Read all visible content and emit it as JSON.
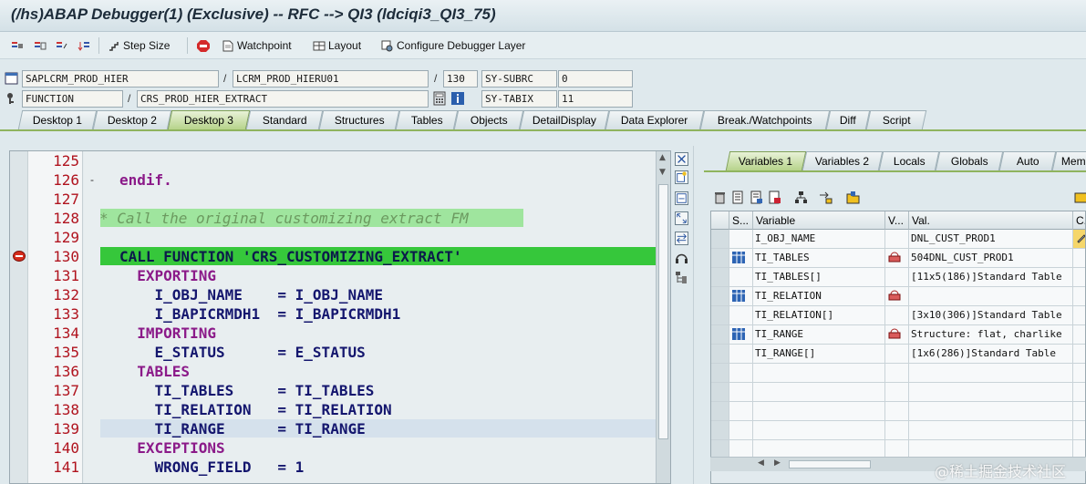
{
  "window": {
    "title": "(/hs)ABAP Debugger(1)  (Exclusive) -- RFC --> QI3 (ldciqi3_QI3_75)"
  },
  "toolbar": {
    "step_size": "Step Size",
    "watchpoint": "Watchpoint",
    "layout": "Layout",
    "configure": "Configure Debugger Layer"
  },
  "info": {
    "program": "SAPLCRM_PROD_HIER",
    "include": "LCRM_PROD_HIERU01",
    "line": "130",
    "subrc_label": "SY-SUBRC",
    "subrc_value": "0",
    "event_type": "FUNCTION",
    "event_name": "CRS_PROD_HIER_EXTRACT",
    "tabix_label": "SY-TABIX",
    "tabix_value": "11"
  },
  "tabs": [
    "Desktop 1",
    "Desktop 2",
    "Desktop 3",
    "Standard",
    "Structures",
    "Tables",
    "Objects",
    "DetailDisplay",
    "Data Explorer",
    "Break./Watchpoints",
    "Diff",
    "Script"
  ],
  "active_tab": "Desktop 3",
  "code": {
    "lines": [
      {
        "n": "125",
        "text": ""
      },
      {
        "n": "126",
        "text": "endif."
      },
      {
        "n": "127",
        "text": ""
      },
      {
        "n": "128",
        "text": "* Call the original customizing extract FM"
      },
      {
        "n": "129",
        "text": ""
      },
      {
        "n": "130",
        "text": "CALL FUNCTION 'CRS_CUSTOMIZING_EXTRACT'"
      },
      {
        "n": "131",
        "text": "  EXPORTING"
      },
      {
        "n": "132",
        "text": "    I_OBJ_NAME    = I_OBJ_NAME"
      },
      {
        "n": "133",
        "text": "    I_BAPICRMDH1  = I_BAPICRMDH1"
      },
      {
        "n": "134",
        "text": "  IMPORTING"
      },
      {
        "n": "135",
        "text": "    E_STATUS      = E_STATUS"
      },
      {
        "n": "136",
        "text": "  TABLES"
      },
      {
        "n": "137",
        "text": "    TI_TABLES     = TI_TABLES"
      },
      {
        "n": "138",
        "text": "    TI_RELATION   = TI_RELATION"
      },
      {
        "n": "139",
        "text": "    TI_RANGE      = TI_RANGE"
      },
      {
        "n": "140",
        "text": "  EXCEPTIONS"
      },
      {
        "n": "141",
        "text": "    WRONG_FIELD   = 1"
      }
    ]
  },
  "right_tabs": [
    "Variables 1",
    "Variables 2",
    "Locals",
    "Globals",
    "Auto",
    "Memo"
  ],
  "right_active": "Variables 1",
  "grid": {
    "headers": [
      "S...",
      "Variable",
      "V...",
      "Val.",
      "C..."
    ],
    "rows": [
      {
        "variable": "I_OBJ_NAME",
        "value": "DNL_CUST_PROD1"
      },
      {
        "variable": "TI_TABLES",
        "value": "504DNL_CUST_PROD1"
      },
      {
        "variable": "TI_TABLES[]",
        "value": "[11x5(186)]Standard Table"
      },
      {
        "variable": "TI_RELATION",
        "value": ""
      },
      {
        "variable": "TI_RELATION[]",
        "value": "[3x10(306)]Standard Table"
      },
      {
        "variable": "TI_RANGE",
        "value": "Structure: flat, charlike"
      },
      {
        "variable": "TI_RANGE[]",
        "value": "[1x6(286)]Standard Table"
      }
    ]
  },
  "watermark": "@稀土掘金技术社区"
}
